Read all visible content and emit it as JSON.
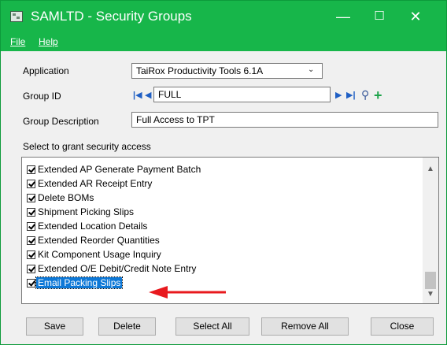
{
  "window": {
    "title": "SAMLTD - Security Groups",
    "controls": {
      "minimize": "—",
      "maximize": "☐",
      "close": "✕"
    }
  },
  "menu": {
    "file": "File",
    "help": "Help"
  },
  "form": {
    "application_label": "Application",
    "application_value": "TaiRox Productivity Tools 6.1A",
    "group_id_label": "Group ID",
    "group_id_value": "FULL",
    "group_description_label": "Group Description",
    "group_description_value": "Full Access to TPT",
    "select_label": "Select to grant security access"
  },
  "list": {
    "items": [
      {
        "label": "Extended AP Generate Payment Batch",
        "checked": true
      },
      {
        "label": "Extended AR Receipt Entry",
        "checked": true
      },
      {
        "label": "Delete BOMs",
        "checked": true
      },
      {
        "label": "Shipment Picking Slips",
        "checked": true
      },
      {
        "label": "Extended Location Details",
        "checked": true
      },
      {
        "label": "Extended Reorder Quantities",
        "checked": true
      },
      {
        "label": "Kit Component Usage Inquiry",
        "checked": true
      },
      {
        "label": "Extended O/E Debit/Credit Note Entry",
        "checked": true
      },
      {
        "label": "Email Packing Slips",
        "checked": true,
        "selected": true
      }
    ]
  },
  "buttons": {
    "save": "Save",
    "delete": "Delete",
    "select_all": "Select All",
    "remove_all": "Remove All",
    "close": "Close"
  },
  "colors": {
    "titlebar": "#17b64a",
    "selection": "#0d78d7",
    "annotation_arrow": "#e8191e"
  }
}
